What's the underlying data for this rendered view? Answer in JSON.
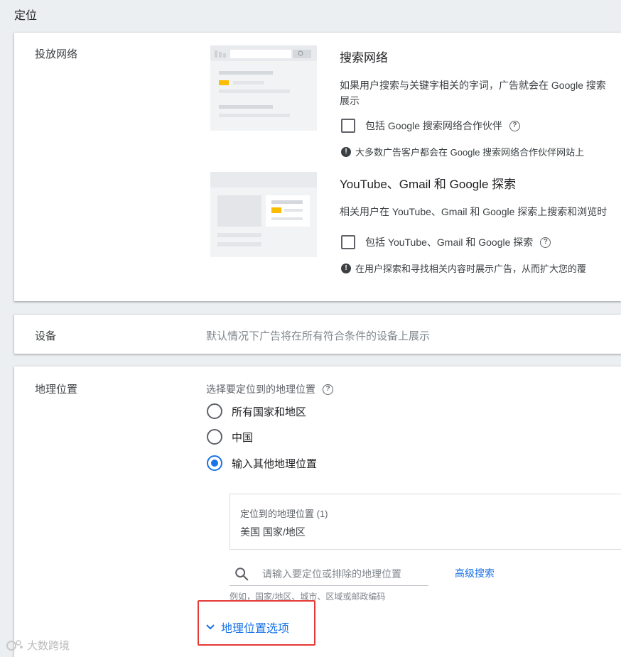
{
  "page": {
    "section_title": "定位"
  },
  "networks": {
    "label": "投放网络",
    "search": {
      "title": "搜索网络",
      "desc_line1": "如果用户搜索与关键字相关的字词，广告就会在 Google 搜索",
      "desc_line2": "展示",
      "checkbox_label": "包括 Google 搜索网络合作伙伴",
      "info": "大多数广告客户都会在 Google 搜索网络合作伙伴网站上"
    },
    "display": {
      "title": "YouTube、Gmail 和 Google 探索",
      "desc": "相关用户在 YouTube、Gmail 和 Google 探索上搜索和浏览时",
      "checkbox_label": "包括 YouTube、Gmail 和 Google 探索",
      "info": "在用户探索和寻找相关内容时展示广告，从而扩大您的覆"
    }
  },
  "devices": {
    "label": "设备",
    "text": "默认情况下广告将在所有符合条件的设备上展示"
  },
  "geo": {
    "label": "地理位置",
    "prompt": "选择要定位到的地理位置",
    "options": [
      {
        "label": "所有国家和地区",
        "checked": false
      },
      {
        "label": "中国",
        "checked": false
      },
      {
        "label": "输入其他地理位置",
        "checked": true
      }
    ],
    "targeted_header": "定位到的地理位置 (1)",
    "targeted_value": "美国 国家/地区",
    "search_placeholder": "请输入要定位或排除的地理位置",
    "advanced_search": "高级搜索",
    "search_hint": "例如，国家/地区、城市、区域或邮政编码",
    "options_toggle": "地理位置选项"
  },
  "watermark": {
    "text": "大数跨境"
  },
  "colors": {
    "accent": "#1a73e8",
    "highlight": "#e53935",
    "ad_yellow": "#fbbc04"
  }
}
